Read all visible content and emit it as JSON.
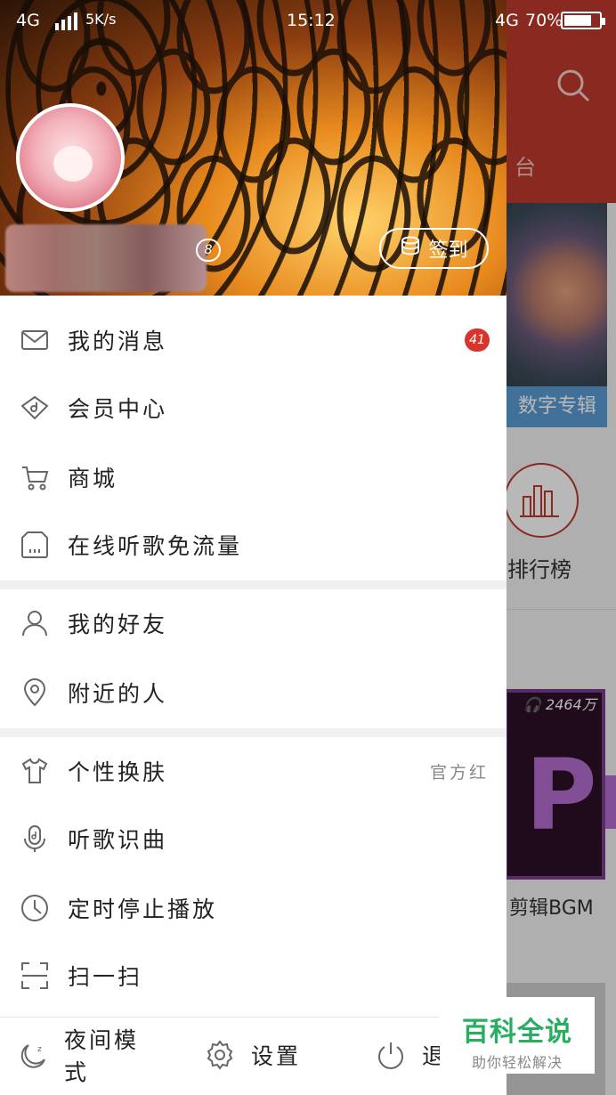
{
  "status_bar": {
    "network_left": "4G",
    "speed": "5K/s",
    "time": "15:12",
    "network_right": "4G",
    "battery": "70%"
  },
  "background_app": {
    "tab_fragment": "台",
    "album_label": "数字专辑",
    "rank_label": "排行榜",
    "play_count": "2464万",
    "video_title": "剪辑BGM",
    "video_letters": "Pr"
  },
  "drawer": {
    "level": "8",
    "signin_label": "签到",
    "menu_group_1": [
      {
        "label": "我的消息",
        "icon": "mail-icon",
        "badge": "41"
      },
      {
        "label": "会员中心",
        "icon": "vip-diamond-icon"
      },
      {
        "label": "商城",
        "icon": "cart-icon"
      },
      {
        "label": "在线听歌免流量",
        "icon": "sim-card-icon"
      }
    ],
    "menu_group_2": [
      {
        "label": "我的好友",
        "icon": "person-icon"
      },
      {
        "label": "附近的人",
        "icon": "location-pin-icon"
      }
    ],
    "menu_group_3": [
      {
        "label": "个性换肤",
        "icon": "tshirt-icon",
        "value": "官方红"
      },
      {
        "label": "听歌识曲",
        "icon": "microphone-note-icon"
      },
      {
        "label": "定时停止播放",
        "icon": "clock-icon"
      },
      {
        "label": "扫一扫",
        "icon": "scan-icon"
      }
    ],
    "bottom_bar": {
      "night_mode": "夜间模式",
      "settings": "设置",
      "exit": "退出"
    }
  },
  "watermark": {
    "title": "百科全说",
    "subtitle": "助你轻松解决"
  },
  "colors": {
    "accent_red": "#c0392b",
    "badge_red": "#d9342b",
    "watermark_green": "#27ae60"
  }
}
